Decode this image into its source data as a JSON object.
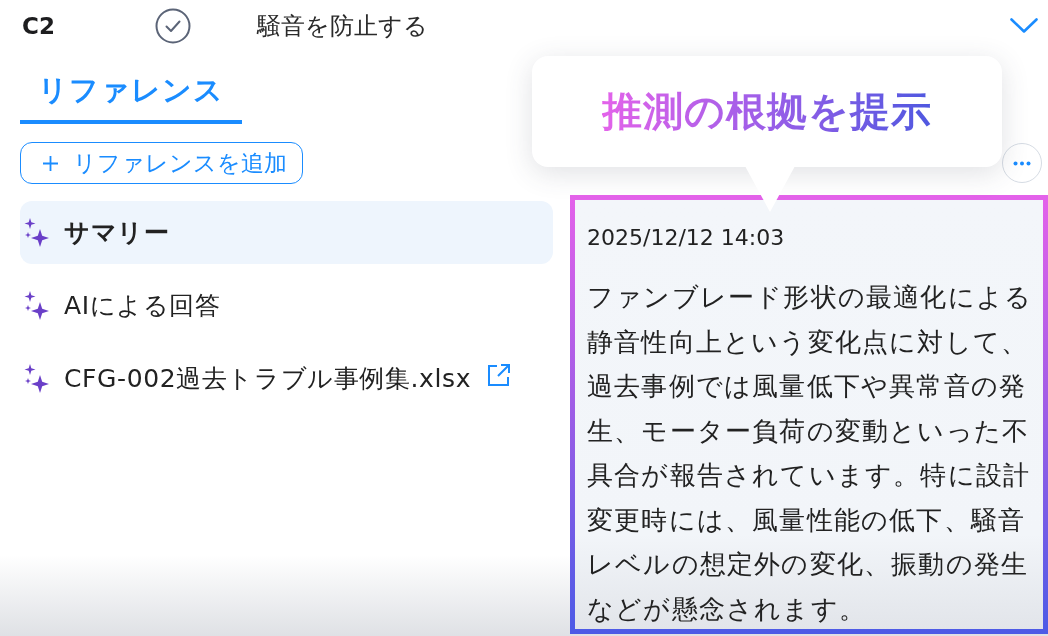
{
  "header": {
    "code": "C2",
    "checked": true,
    "title": "騒音を防止する"
  },
  "tabs": [
    {
      "label": "リファレンス",
      "selected": true
    }
  ],
  "add_button": {
    "label": "リファレンスを追加"
  },
  "references": [
    {
      "label": "サマリー",
      "selected": true,
      "external": false
    },
    {
      "label": "AIによる回答",
      "selected": false,
      "external": false
    },
    {
      "label": "CFG-002過去トラブル事例集.xlsx",
      "selected": false,
      "external": true
    }
  ],
  "callout": {
    "text": "推測の根拠を提示"
  },
  "detail": {
    "timestamp": "2025/12/12 14:03",
    "body": "ファンブレード形状の最適化による静音性向上という変化点に対して、過去事例では風量低下や異常音の発生、モーター負荷の変動といった不具合が報告されています。特に設計変更時には、風量性能の低下、騒音レベルの想定外の変化、振動の発生などが懸念されます。"
  }
}
